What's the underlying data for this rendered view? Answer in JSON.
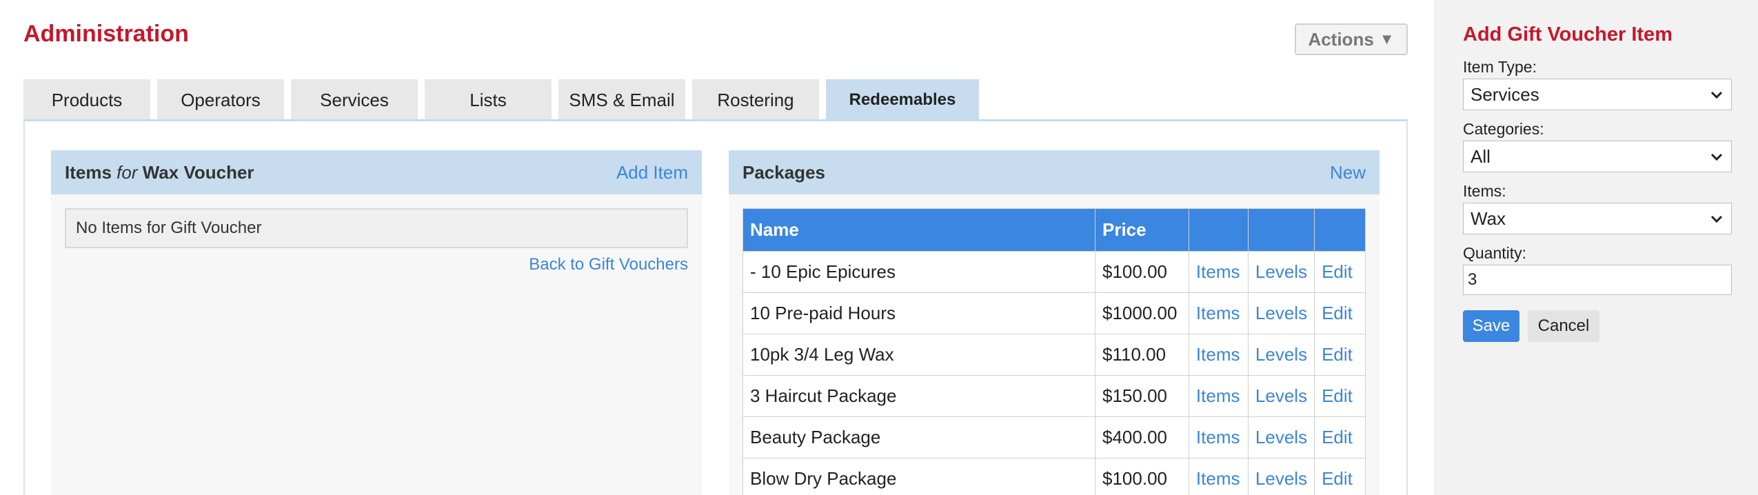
{
  "header": {
    "title": "Administration",
    "actions_label": "Actions",
    "actions_icon": "triangle-down-icon"
  },
  "tabs": [
    {
      "label": "Products",
      "active": false
    },
    {
      "label": "Operators",
      "active": false
    },
    {
      "label": "Services",
      "active": false
    },
    {
      "label": "Lists",
      "active": false
    },
    {
      "label": "SMS & Email",
      "active": false
    },
    {
      "label": "Rostering",
      "active": false
    },
    {
      "label": "Redeemables",
      "active": true
    }
  ],
  "items_panel": {
    "title_prefix": "Items",
    "title_for": "for",
    "title_name": "Wax Voucher",
    "add_link": "Add Item",
    "empty_text": "No Items for Gift Voucher",
    "back_link": "Back to Gift Vouchers"
  },
  "packages_panel": {
    "title": "Packages",
    "new_link": "New",
    "columns": [
      "Name",
      "Price",
      "",
      "",
      ""
    ],
    "rows": [
      {
        "name": "- 10 Epic Epicures",
        "price": "$100.00",
        "items": "Items",
        "levels": "Levels",
        "edit": "Edit"
      },
      {
        "name": "10 Pre-paid Hours",
        "price": "$1000.00",
        "items": "Items",
        "levels": "Levels",
        "edit": "Edit"
      },
      {
        "name": "10pk 3/4 Leg Wax",
        "price": "$110.00",
        "items": "Items",
        "levels": "Levels",
        "edit": "Edit"
      },
      {
        "name": "3 Haircut Package",
        "price": "$150.00",
        "items": "Items",
        "levels": "Levels",
        "edit": "Edit"
      },
      {
        "name": "Beauty Package",
        "price": "$400.00",
        "items": "Items",
        "levels": "Levels",
        "edit": "Edit"
      },
      {
        "name": "Blow Dry Package",
        "price": "$100.00",
        "items": "Items",
        "levels": "Levels",
        "edit": "Edit"
      }
    ]
  },
  "sidebar": {
    "title": "Add Gift Voucher Item",
    "item_type_label": "Item Type:",
    "item_type_value": "Services",
    "categories_label": "Categories:",
    "categories_value": "All",
    "items_label": "Items:",
    "items_value": "Wax",
    "quantity_label": "Quantity:",
    "quantity_value": "3",
    "save_label": "Save",
    "cancel_label": "Cancel"
  },
  "colors": {
    "accent_red": "#c4182c",
    "tab_active": "#c7dcee",
    "table_header": "#3b86e0",
    "link": "#3b86d8"
  }
}
